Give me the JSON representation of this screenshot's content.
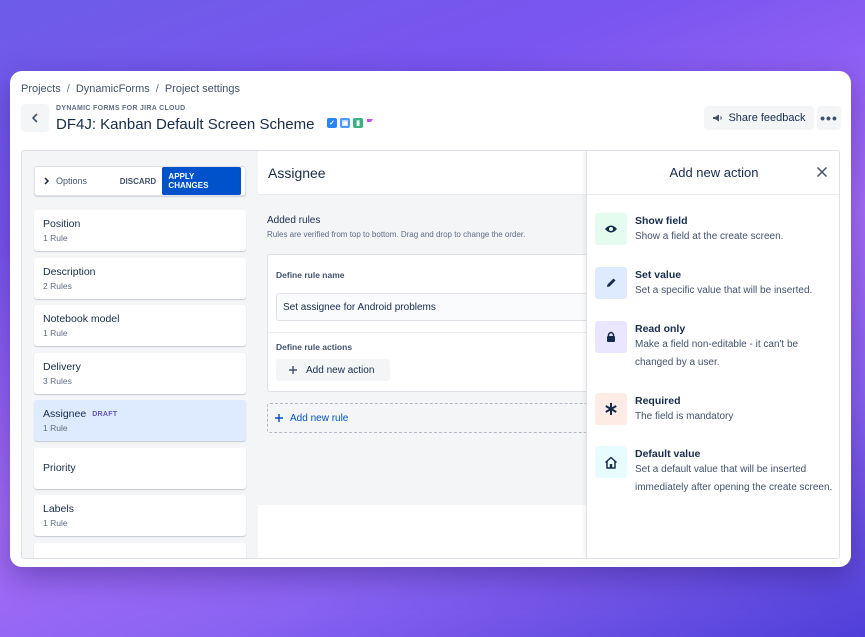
{
  "breadcrumb": [
    "Projects",
    "DynamicForms",
    "Project settings"
  ],
  "breadcrumb_separator": "/",
  "header": {
    "overline": "DYNAMIC FORMS FOR JIRA CLOUD",
    "title": "DF4J: Kanban Default Screen Scheme",
    "share_label": "Share feedback",
    "more_label": "•••"
  },
  "toolbar": {
    "options_label": "Options",
    "discard_label": "DISCARD",
    "apply_label": "APPLY CHANGES"
  },
  "fields": [
    {
      "name": "Position",
      "rules": "1 Rule",
      "draft": ""
    },
    {
      "name": "Description",
      "rules": "2 Rules",
      "draft": ""
    },
    {
      "name": "Notebook model",
      "rules": "1 Rule",
      "draft": ""
    },
    {
      "name": "Delivery",
      "rules": "3 Rules",
      "draft": ""
    },
    {
      "name": "Assignee",
      "rules": "1 Rule",
      "draft": "DRAFT"
    },
    {
      "name": "Priority",
      "rules": "",
      "draft": ""
    },
    {
      "name": "Labels",
      "rules": "1 Rule",
      "draft": ""
    }
  ],
  "middle": {
    "title": "Assignee",
    "added_rules_title": "Added rules",
    "added_rules_sub": "Rules are verified from top to bottom. Drag and drop to change the order.",
    "rule_name_label": "Define rule name",
    "rule_name_value": "Set assignee for Android problems",
    "rule_actions_label": "Define rule actions",
    "add_action_label": "Add new action",
    "add_rule_label": "Add new rule"
  },
  "panel": {
    "title": "Add new action",
    "actions": [
      {
        "title": "Show field",
        "desc": "Show a field at the create screen.",
        "icon": "eye-icon",
        "bg": "#e3fcef"
      },
      {
        "title": "Set value",
        "desc": "Set a specific value that will be inserted.",
        "icon": "pencil-icon",
        "bg": "#deebff"
      },
      {
        "title": "Read only",
        "desc": "Make a field non-editable - it can't be changed by a user.",
        "icon": "lock-icon",
        "bg": "#eae6ff"
      },
      {
        "title": "Required",
        "desc": "The field is mandatory",
        "icon": "asterisk-icon",
        "bg": "#ffebe6"
      },
      {
        "title": "Default value",
        "desc": "Set a default value that will be inserted immediately after opening the create screen.",
        "icon": "home-icon",
        "bg": "#e6fcff"
      }
    ]
  },
  "colors": {
    "primary": "#0052cc",
    "draft": "#6554c0",
    "active_item": "#deebff"
  }
}
